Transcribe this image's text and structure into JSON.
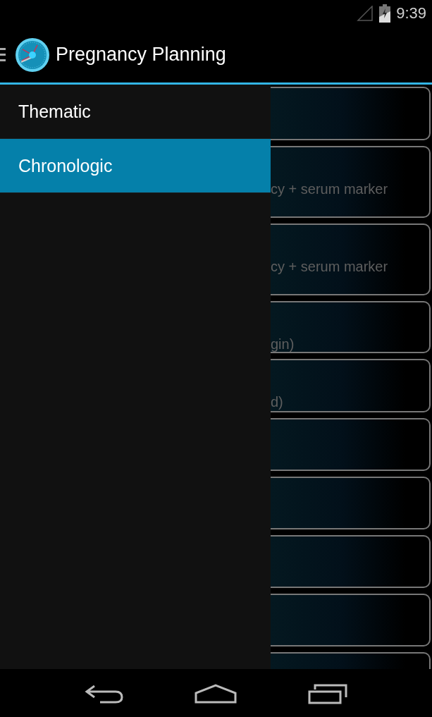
{
  "status_bar": {
    "time": "9:39"
  },
  "action_bar": {
    "title": "Pregnancy Planning"
  },
  "drawer": {
    "items": [
      {
        "label": "Thematic",
        "selected": false
      },
      {
        "label": "Chronologic",
        "selected": true
      }
    ]
  },
  "cards": [
    {
      "kind": "blank"
    },
    {
      "kind": "text",
      "text": "cy + serum marker"
    },
    {
      "kind": "text",
      "text": "cy + serum marker"
    },
    {
      "kind": "text",
      "text": "gin)"
    },
    {
      "kind": "text",
      "text": "d)"
    },
    {
      "kind": "blank"
    },
    {
      "kind": "blank"
    },
    {
      "kind": "blank"
    },
    {
      "kind": "blank"
    },
    {
      "kind": "blank"
    }
  ]
}
